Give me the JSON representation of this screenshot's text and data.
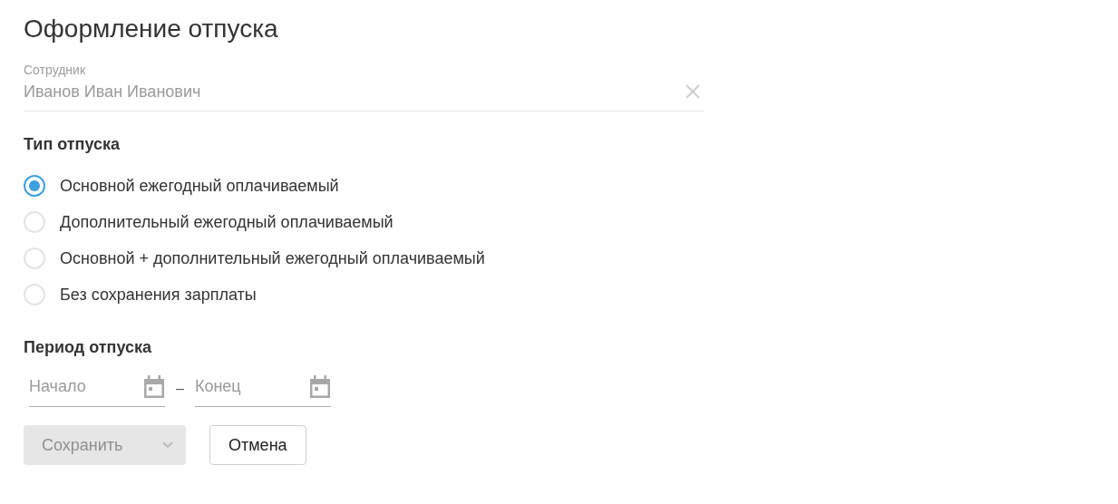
{
  "title": "Оформление отпуска",
  "employee": {
    "label": "Сотрудник",
    "value": "Иванов Иван Иванович",
    "disabled": true
  },
  "vacation_type": {
    "heading": "Тип отпуска",
    "options": [
      {
        "label": "Основной ежегодный оплачиваемый",
        "selected": true
      },
      {
        "label": "Дополнительный ежегодный оплачиваемый",
        "selected": false
      },
      {
        "label": "Основной + дополнительный ежегодный оплачиваемый",
        "selected": false
      },
      {
        "label": "Без сохранения зарплаты",
        "selected": false
      }
    ]
  },
  "period": {
    "heading": "Период отпуска",
    "start": {
      "placeholder": "Начало"
    },
    "separator": "–",
    "end": {
      "placeholder": "Конец"
    }
  },
  "buttons": {
    "save": {
      "label": "Сохранить",
      "disabled": true
    },
    "cancel": {
      "label": "Отмена"
    }
  }
}
